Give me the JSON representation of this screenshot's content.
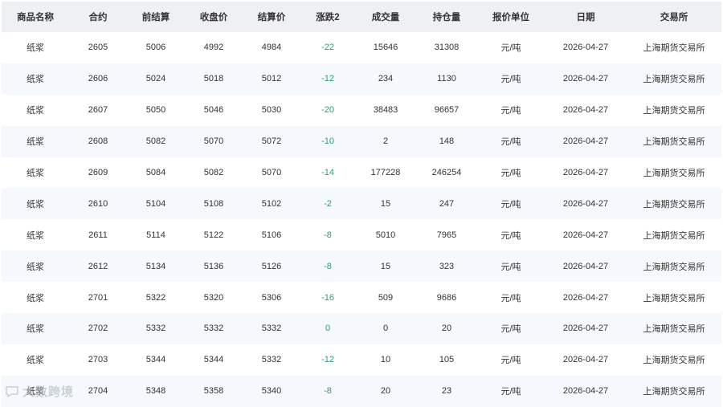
{
  "table": {
    "headers": [
      "商品名称",
      "合约",
      "前结算",
      "收盘价",
      "结算价",
      "涨跌2",
      "成交量",
      "持仓量",
      "报价单位",
      "日期",
      "交易所"
    ],
    "rows": [
      [
        "纸浆",
        "2605",
        "5006",
        "4992",
        "4984",
        "-22",
        "15646",
        "31308",
        "元/吨",
        "2026-04-27",
        "上海期货交易所"
      ],
      [
        "纸浆",
        "2606",
        "5024",
        "5018",
        "5012",
        "-12",
        "234",
        "1130",
        "元/吨",
        "2026-04-27",
        "上海期货交易所"
      ],
      [
        "纸浆",
        "2607",
        "5050",
        "5046",
        "5030",
        "-20",
        "38483",
        "96657",
        "元/吨",
        "2026-04-27",
        "上海期货交易所"
      ],
      [
        "纸浆",
        "2608",
        "5082",
        "5070",
        "5072",
        "-10",
        "2",
        "148",
        "元/吨",
        "2026-04-27",
        "上海期货交易所"
      ],
      [
        "纸浆",
        "2609",
        "5084",
        "5082",
        "5070",
        "-14",
        "177228",
        "246254",
        "元/吨",
        "2026-04-27",
        "上海期货交易所"
      ],
      [
        "纸浆",
        "2610",
        "5104",
        "5108",
        "5102",
        "-2",
        "15",
        "247",
        "元/吨",
        "2026-04-27",
        "上海期货交易所"
      ],
      [
        "纸浆",
        "2611",
        "5114",
        "5122",
        "5106",
        "-8",
        "5010",
        "7965",
        "元/吨",
        "2026-04-27",
        "上海期货交易所"
      ],
      [
        "纸浆",
        "2612",
        "5134",
        "5136",
        "5126",
        "-8",
        "15",
        "323",
        "元/吨",
        "2026-04-27",
        "上海期货交易所"
      ],
      [
        "纸浆",
        "2701",
        "5322",
        "5320",
        "5306",
        "-16",
        "509",
        "9686",
        "元/吨",
        "2026-04-27",
        "上海期货交易所"
      ],
      [
        "纸浆",
        "2702",
        "5332",
        "5332",
        "5332",
        "0",
        "0",
        "20",
        "元/吨",
        "2026-04-27",
        "上海期货交易所"
      ],
      [
        "纸浆",
        "2703",
        "5344",
        "5344",
        "5332",
        "-12",
        "10",
        "105",
        "元/吨",
        "2026-04-27",
        "上海期货交易所"
      ],
      [
        "纸浆",
        "2704",
        "5348",
        "5358",
        "5340",
        "-8",
        "20",
        "23",
        "元/吨",
        "2026-04-27",
        "上海期货交易所"
      ]
    ]
  },
  "watermark": {
    "text": "大数跨境",
    "icon": "chat-bubble-icon"
  },
  "colors": {
    "header_bg": "#eef0f4",
    "row_alt_bg": "#f5f9fd",
    "change_text": "#2a9d6f",
    "text": "#333333"
  }
}
